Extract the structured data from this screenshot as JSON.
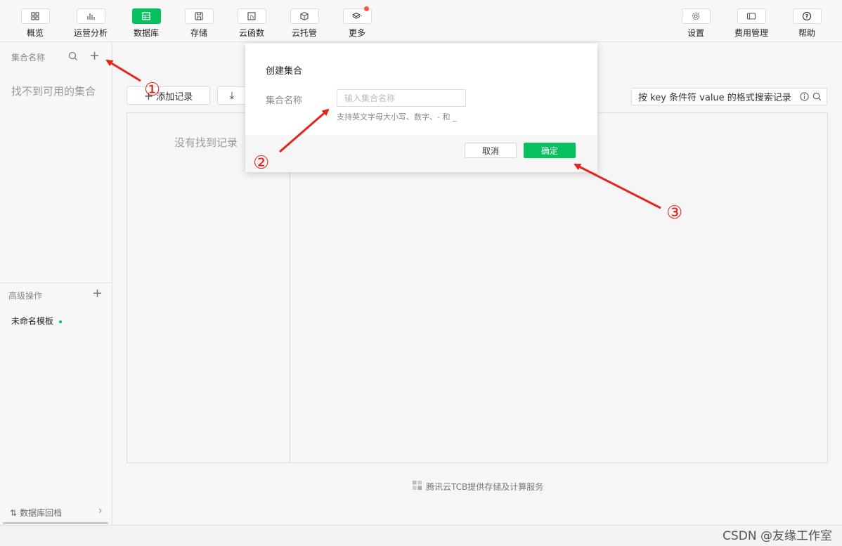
{
  "toolbar": {
    "items": [
      {
        "label": "概览",
        "icon": "grid-icon"
      },
      {
        "label": "运营分析",
        "icon": "bar-chart-icon"
      },
      {
        "label": "数据库",
        "icon": "database-icon",
        "active": true
      },
      {
        "label": "存储",
        "icon": "save-icon"
      },
      {
        "label": "云函数",
        "icon": "function-icon"
      },
      {
        "label": "云托管",
        "icon": "cube-icon"
      },
      {
        "label": "更多",
        "icon": "layers-icon",
        "badge": true
      }
    ],
    "right_items": [
      {
        "label": "设置",
        "icon": "gear-icon"
      },
      {
        "label": "费用管理",
        "icon": "billing-icon"
      },
      {
        "label": "帮助",
        "icon": "help-icon"
      }
    ]
  },
  "sidebar": {
    "title": "集合名称",
    "empty_text": "找不到可用的集合",
    "advanced_title": "高级操作",
    "template_item": "未命名模板",
    "rollback": "数据库回档"
  },
  "main": {
    "add_record": "添加记录",
    "search_placeholder": "按 key 条件符 value 的格式搜索记录",
    "no_records": "没有找到记录",
    "footer_note": "腾讯云TCB提供存储及计算服务"
  },
  "modal": {
    "title": "创建集合",
    "field_label": "集合名称",
    "input_placeholder": "输入集合名称",
    "hint": "支持英文字母大小写、数字、- 和 _",
    "cancel": "取消",
    "confirm": "确定"
  },
  "annotations": {
    "step1": "①",
    "step2": "②",
    "step3": "③",
    "color": "#e8231b"
  },
  "watermark": "CSDN @友缘工作室",
  "colors": {
    "accent": "#07c160",
    "badge": "#fa5151"
  }
}
